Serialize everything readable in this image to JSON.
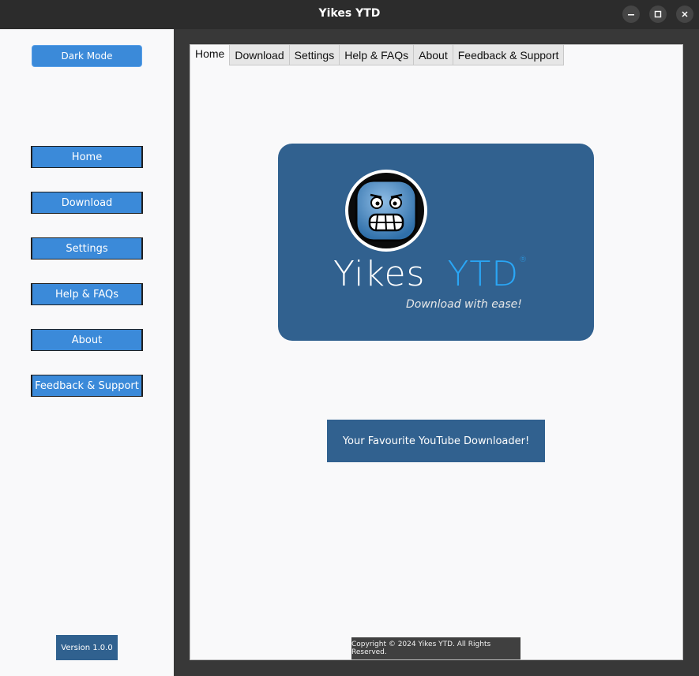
{
  "window": {
    "title": "Yikes YTD",
    "minimize_icon": "minimize-icon",
    "maximize_icon": "maximize-icon",
    "close_icon": "close-icon"
  },
  "sidebar": {
    "dark_mode_label": "Dark Mode",
    "items": [
      {
        "label": "Home"
      },
      {
        "label": "Download"
      },
      {
        "label": "Settings"
      },
      {
        "label": "Help & FAQs"
      },
      {
        "label": "About"
      },
      {
        "label": "Feedback & Support"
      }
    ],
    "version": "Version 1.0.0",
    "accent_color": "#3b8ad9"
  },
  "main": {
    "tabs": [
      {
        "label": "Home"
      },
      {
        "label": "Download"
      },
      {
        "label": "Settings"
      },
      {
        "label": "Help & FAQs"
      },
      {
        "label": "About"
      },
      {
        "label": "Feedback & Support"
      }
    ],
    "active_tab": "Home",
    "hero": {
      "brand_primary": "Yikes",
      "brand_secondary": "YTD",
      "registered_mark": "®",
      "tagline": "Download with ease!",
      "background_color": "#31618f",
      "logo_icon": "grimacing-face-icon"
    },
    "favourite_button": "Your Favourite YouTube Downloader!",
    "copyright": "Copyright © 2024 Yikes YTD. All Rights Reserved."
  }
}
